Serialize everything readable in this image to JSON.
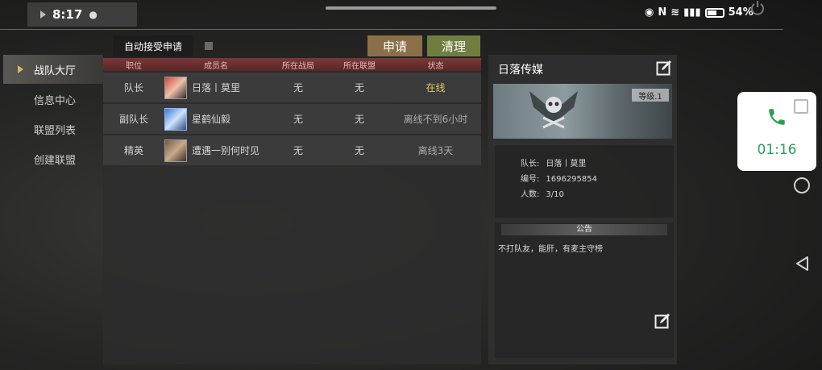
{
  "status_bar": {
    "time": "8:17",
    "wechat_icon": "wechat-icon",
    "battery": "54%"
  },
  "menu": [
    {
      "label": "战队大厅",
      "active": true
    },
    {
      "label": "信息中心",
      "active": false
    },
    {
      "label": "联盟列表",
      "active": false
    },
    {
      "label": "创建联盟",
      "active": false
    }
  ],
  "controls": {
    "auto_accept": "自动接受申请",
    "apply": "申请",
    "clean": "清理"
  },
  "table": {
    "headers": [
      "职位",
      "成员名",
      "所在战局",
      "所在联盟",
      "状态"
    ],
    "rows": [
      {
        "position": "队长",
        "name": "日落丨莫里",
        "battle": "无",
        "alliance": "无",
        "status": "在线"
      },
      {
        "position": "副队长",
        "name": "星鹤仙毅",
        "battle": "无",
        "alliance": "无",
        "status": "离线不到6小时"
      },
      {
        "position": "精英",
        "name": "遭遇一别何时见",
        "battle": "无",
        "alliance": "无",
        "status": "离线3天"
      }
    ]
  },
  "team": {
    "name": "日落传媒",
    "level": "等级.1",
    "leader_label": "队长:",
    "leader_value": "日落丨莫里",
    "id_label": "编号:",
    "id_value": "1696295854",
    "count_label": "人数:",
    "count_value": "3/10",
    "notice_title": "公告",
    "notice_text": "不打队友，能肝，有麦主守榜"
  },
  "call": {
    "duration": "01:16"
  },
  "colors": {
    "online": "#d8d060",
    "apply": "#8a6f48",
    "clean": "#6f7e3e",
    "call_green": "#2e9e55"
  }
}
